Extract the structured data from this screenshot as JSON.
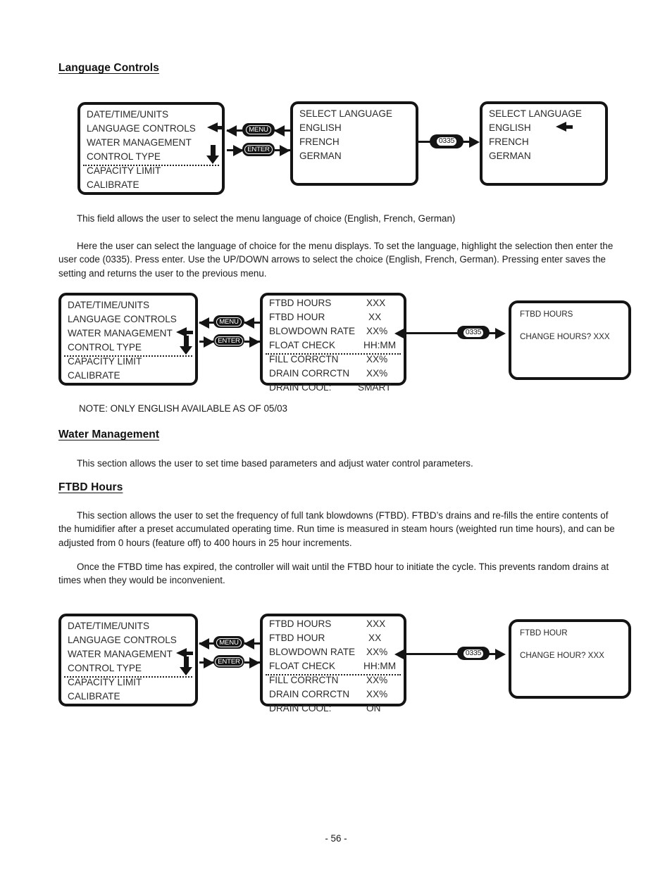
{
  "document": {
    "page_number": "- 56 -"
  },
  "sections": {
    "language_controls_heading": "Language Controls",
    "water_management_heading": "Water Management",
    "ftbd_hours_heading": "FTBD Hours",
    "para_language_field": "This field allows the user to select the menu language of choice (English, French, German)",
    "para_language_detail": "Here the user can select the language of choice for the menu displays. To set the language, highlight the selection then enter the user code (0335). Press enter. Use the UP/DOWN arrows to select the choice (English, French, German). Pressing enter saves the setting and returns the user to the previous menu.",
    "note_english_only": "NOTE: ONLY ENGLISH AVAILABLE AS OF 05/03",
    "para_water_management": "This section allows the user to set time based parameters and adjust water control parameters.",
    "para_ftbd_1": "This section allows the user to set the frequency of  full tank blowdowns (FTBD). FTBD’s drains and re-fills the entire contents of the humidifier after a preset accumulated operating time. Run time is measured in steam hours (weighted run time hours), and can be adjusted from 0 hours (feature off) to 400 hours in 25 hour increments.",
    "para_ftbd_2": "Once the FTBD time has expired, the controller will wait until the FTBD hour to initiate the cycle. This prevents random drains at times when they would be inconvenient."
  },
  "keys": {
    "menu": "MENU",
    "enter": "ENTER",
    "user_code": "0335"
  },
  "diagram1": {
    "main_menu": {
      "rows": [
        {
          "label": "DATE/TIME/UNITS",
          "value": ""
        },
        {
          "label": "LANGUAGE CONTROLS",
          "value": ""
        },
        {
          "label": "WATER MANAGEMENT",
          "value": ""
        },
        {
          "label": "CONTROL TYPE",
          "value": ""
        },
        {
          "label": "CAPACITY LIMIT",
          "value": ""
        },
        {
          "label": "CALIBRATE",
          "value": ""
        }
      ],
      "selected_row": "LANGUAGE CONTROLS"
    },
    "select_language": {
      "rows": [
        {
          "label": "SELECT LANGUAGE",
          "value": ""
        },
        {
          "label": "ENGLISH",
          "value": ""
        },
        {
          "label": "FRENCH",
          "value": ""
        },
        {
          "label": "GERMAN",
          "value": ""
        }
      ]
    },
    "select_language_code": {
      "rows": [
        {
          "label": "SELECT LANGUAGE",
          "value": ""
        },
        {
          "label": "ENGLISH",
          "value": ""
        },
        {
          "label": "FRENCH",
          "value": ""
        },
        {
          "label": "GERMAN",
          "value": ""
        }
      ],
      "selected_row": "ENGLISH"
    }
  },
  "diagram2": {
    "main_menu": {
      "rows": [
        {
          "label": "DATE/TIME/UNITS",
          "value": ""
        },
        {
          "label": "LANGUAGE CONTROLS",
          "value": ""
        },
        {
          "label": "WATER MANAGEMENT",
          "value": ""
        },
        {
          "label": "CONTROL TYPE",
          "value": ""
        },
        {
          "label": "CAPACITY LIMIT",
          "value": ""
        },
        {
          "label": "CALIBRATE",
          "value": ""
        }
      ],
      "selected_row": "WATER MANAGEMENT"
    },
    "water_menu": {
      "rows": [
        {
          "label": "FTBD HOURS",
          "value": "XXX"
        },
        {
          "label": "FTBD HOUR",
          "value": "XX"
        },
        {
          "label": "BLOWDOWN RATE",
          "value": "XX%"
        },
        {
          "label": "FLOAT CHECK",
          "value": "HH:MM"
        },
        {
          "label": "FILL CORRCTN",
          "value": "XX%"
        },
        {
          "label": "DRAIN CORRCTN",
          "value": "XX%"
        },
        {
          "label": "DRAIN COOL:",
          "value": "SMART"
        }
      ]
    },
    "prompt": {
      "title": "FTBD HOURS",
      "question": "CHANGE HOURS?  XXX"
    }
  },
  "diagram3": {
    "main_menu": {
      "rows": [
        {
          "label": "DATE/TIME/UNITS",
          "value": ""
        },
        {
          "label": "LANGUAGE CONTROLS",
          "value": ""
        },
        {
          "label": "WATER MANAGEMENT",
          "value": ""
        },
        {
          "label": "CONTROL TYPE",
          "value": ""
        },
        {
          "label": "CAPACITY LIMIT",
          "value": ""
        },
        {
          "label": "CALIBRATE",
          "value": ""
        }
      ],
      "selected_row": "WATER MANAGEMENT"
    },
    "water_menu": {
      "rows": [
        {
          "label": "FTBD HOURS",
          "value": "XXX"
        },
        {
          "label": "FTBD HOUR",
          "value": "XX"
        },
        {
          "label": "BLOWDOWN RATE",
          "value": "XX%"
        },
        {
          "label": "FLOAT CHECK",
          "value": "HH:MM"
        },
        {
          "label": "FILL CORRCTN",
          "value": "XX%"
        },
        {
          "label": "DRAIN CORRCTN",
          "value": "XX%"
        },
        {
          "label": "DRAIN COOL:",
          "value": "ON"
        }
      ]
    },
    "prompt": {
      "title": "FTBD HOUR",
      "question": "CHANGE HOUR?  XXX"
    }
  }
}
